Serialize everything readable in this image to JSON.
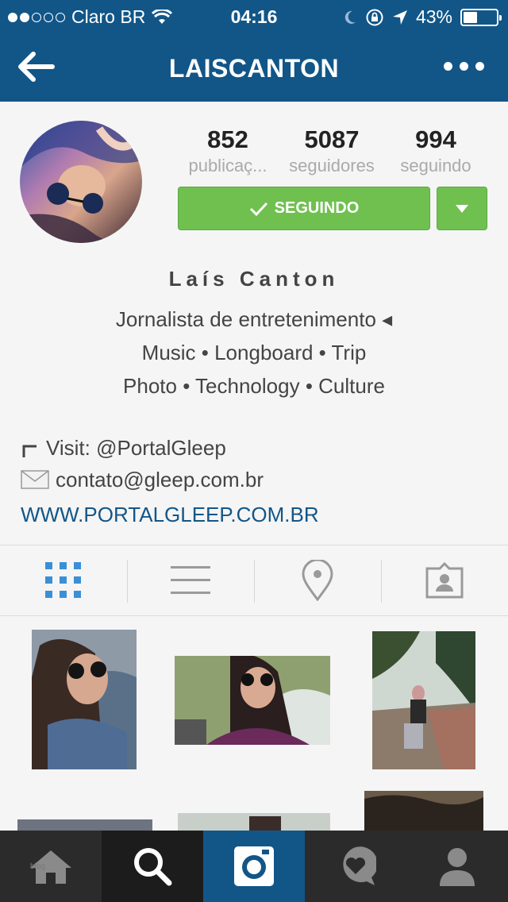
{
  "status_bar": {
    "carrier": "Claro BR",
    "time": "04:16",
    "battery": "43%",
    "battery_level": 0.43
  },
  "header": {
    "title": "LAISCANTON",
    "back_icon": "back-arrow-icon",
    "more_icon": "more-icon"
  },
  "profile": {
    "stats": [
      {
        "value": "852",
        "label": "publicaç..."
      },
      {
        "value": "5087",
        "label": "seguidores"
      },
      {
        "value": "994",
        "label": "seguindo"
      }
    ],
    "follow_label": "SEGUINDO",
    "name": "Laís Canton",
    "bio_lines": [
      "Jornalista de entretenimento ◂",
      "Music • Longboard • Trip",
      "Photo • Technology • Culture"
    ],
    "visit": "Visit: @PortalGleep",
    "email": "contato@gleep.com.br",
    "website": "WWW.PORTALGLEEP.COM.BR"
  },
  "tabs": [
    "grid-icon",
    "list-icon",
    "location-pin-icon",
    "tagged-photos-icon"
  ],
  "bottom_nav": {
    "blog_label": "blog",
    "items": [
      "home-icon",
      "search-icon",
      "camera-icon",
      "activity-heart-icon",
      "profile-icon"
    ]
  },
  "colors": {
    "brand": "#125688",
    "follow_green": "#70c050",
    "tab_active": "#3b8fd6"
  }
}
